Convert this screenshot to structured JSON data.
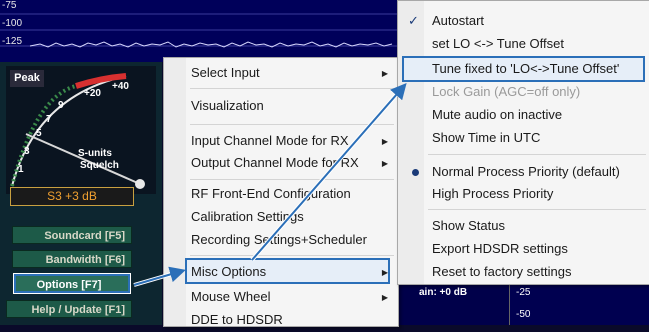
{
  "spectrum": {
    "labels": [
      "-75",
      "-100",
      "-125"
    ]
  },
  "smeter": {
    "peak_label": "Peak",
    "scale_plus20": "+20",
    "scale_plus40": "+40",
    "scale_9": "9",
    "scale_7": "7",
    "scale_5": "5",
    "scale_3": "3",
    "scale_1": "1",
    "sunits": "S-units",
    "squelch": "Squelch",
    "readout": "S3 +3 dB"
  },
  "app_buttons": {
    "soundcard": "Soundcard [F5]",
    "bandwidth": "Bandwidth [F6]",
    "options": "Options [F7]",
    "help": "Help / Update [F1]"
  },
  "bottom": {
    "gain": "ain: +0 dB",
    "scale_a": "-25",
    "scale_b": "-50"
  },
  "main_menu": {
    "items": [
      {
        "label": "Select Input"
      },
      {
        "label": "Visualization"
      },
      {
        "label": "Input Channel Mode for RX"
      },
      {
        "label": "Output Channel Mode for RX"
      },
      {
        "label": "RF Front-End Configuration"
      },
      {
        "label": "Calibration Settings"
      },
      {
        "label": "Recording Settings+Scheduler"
      },
      {
        "label": "Misc Options"
      },
      {
        "label": "Mouse Wheel"
      },
      {
        "label": "DDE to HDSDR"
      }
    ]
  },
  "sub_menu": {
    "items": [
      {
        "label": "Autostart"
      },
      {
        "label": "set LO <-> Tune Offset"
      },
      {
        "label": "Tune fixed to 'LO<->Tune Offset'"
      },
      {
        "label": "Lock Gain (AGC=off only)"
      },
      {
        "label": "Mute audio on inactive"
      },
      {
        "label": "Show Time in UTC"
      },
      {
        "label": "Normal Process Priority (default)"
      },
      {
        "label": "High Process Priority"
      },
      {
        "label": "Show Status"
      },
      {
        "label": "Export HDSDR settings"
      },
      {
        "label": "Reset to factory settings"
      }
    ]
  },
  "colors": {
    "highlight_border": "#2b6fb8",
    "menu_bg": "#f5f5f5",
    "app_bg": "#0d2630"
  }
}
